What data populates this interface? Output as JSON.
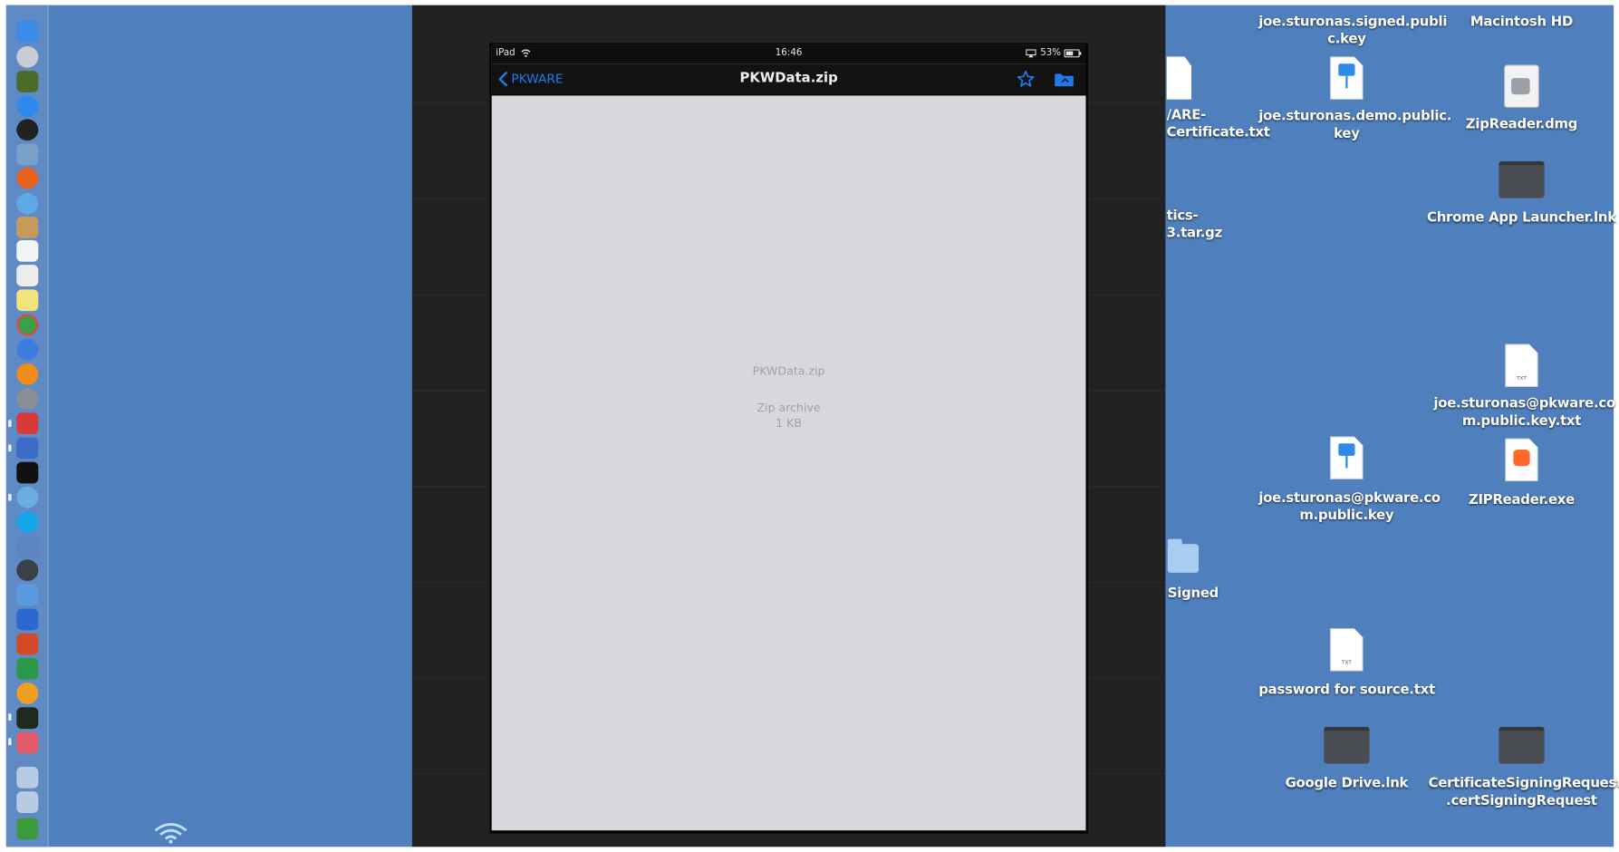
{
  "ipad": {
    "status_left": "iPad",
    "status_time": "16:46",
    "status_battery": "53%",
    "nav": {
      "back_label": "PKWARE",
      "title": "PKWData.zip"
    },
    "file": {
      "name": "PKWData.zip",
      "type": "Zip archive",
      "size": "1 KB"
    }
  },
  "desktop_icons": [
    {
      "id": "signed-key",
      "label": "joe.sturonas.signed.publi\nc.key"
    },
    {
      "id": "macintosh-hd",
      "label": "Macintosh HD"
    },
    {
      "id": "pkware-cert",
      "label": "/ARE-\nCertificate.txt"
    },
    {
      "id": "demo-key",
      "label": "joe.sturonas.demo.public.\nkey"
    },
    {
      "id": "zipreader-dmg",
      "label": "ZipReader.dmg"
    },
    {
      "id": "chrome-launcher",
      "label": "Chrome App Launcher.lnk"
    },
    {
      "id": "tar-gz",
      "label": "tics-\n3.tar.gz"
    },
    {
      "id": "public-key-txt",
      "label": "joe.sturonas@pkware.co\nm.public.key.txt"
    },
    {
      "id": "public-key",
      "label": "joe.sturonas@pkware.co\nm.public.key"
    },
    {
      "id": "zipreader-exe",
      "label": "ZIPReader.exe"
    },
    {
      "id": "signed-folder",
      "label": "Signed"
    },
    {
      "id": "password-txt",
      "label": "password for source.txt"
    },
    {
      "id": "google-drive",
      "label": "Google Drive.lnk"
    },
    {
      "id": "csr",
      "label": "CertificateSigningRequest\n.certSigningRequest"
    }
  ],
  "doc_tag": "TXT",
  "colors": {
    "desktop": "#4f7fbd",
    "ios_tint": "#1f7bea",
    "ipad_screen": "#d8d7dc"
  }
}
